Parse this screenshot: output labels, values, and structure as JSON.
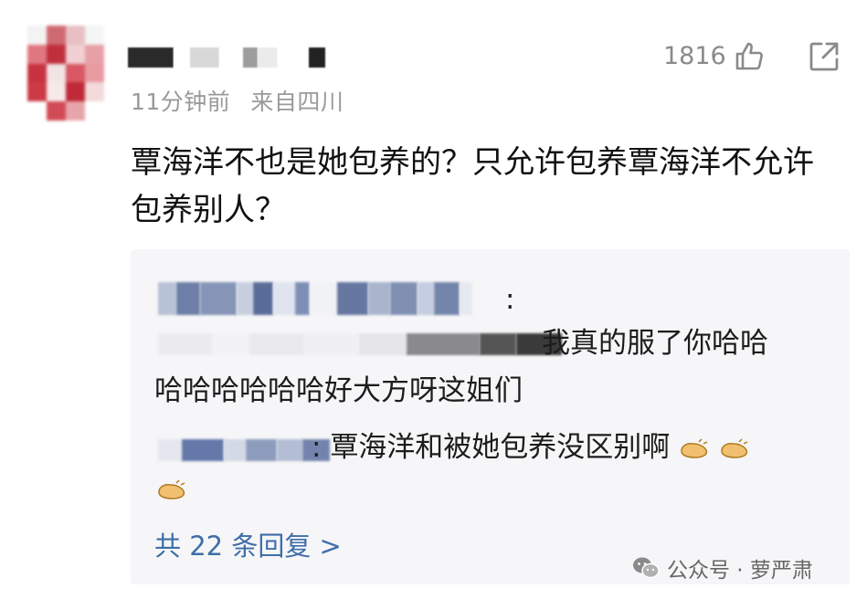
{
  "comment": {
    "time": "11分钟前",
    "location": "来自四川",
    "like_count": "1816",
    "text": "覃海洋不也是她包养的？只允许包养覃海洋不允许包养别人？"
  },
  "replies": [
    {
      "separator": ":",
      "text_line1": "我真的服了你哈哈",
      "text_line2": "哈哈哈哈哈哈好大方呀这姐们"
    },
    {
      "separator": ":",
      "text": "覃海洋和被她包养没区别啊",
      "emoji": "clapping-emoji"
    }
  ],
  "more_replies_label": "共 22 条回复 >",
  "watermark": {
    "text": "公众号 · 萝严肃",
    "icon": "wechat-icon"
  },
  "colors": {
    "link": "#3f6ea8",
    "meta": "#9a9a9a",
    "reply_bg": "#f6f6f8"
  }
}
